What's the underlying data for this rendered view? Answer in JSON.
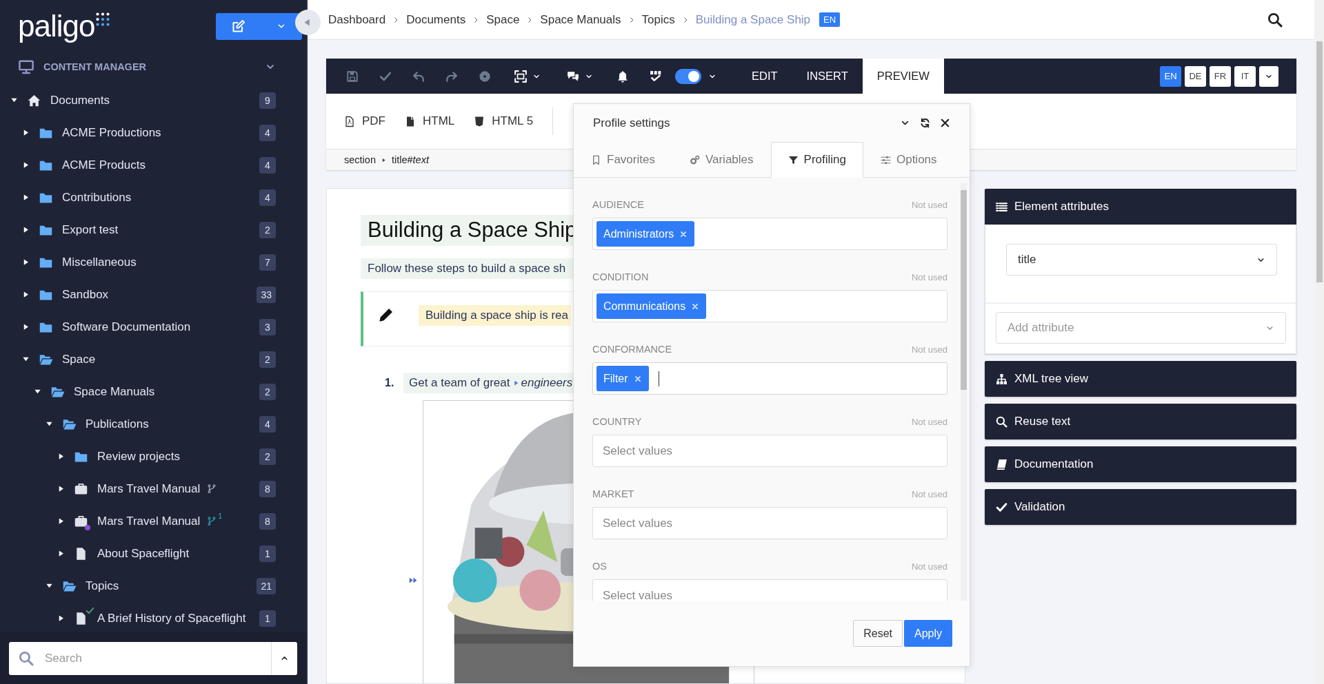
{
  "sidebar": {
    "logo": "paligo",
    "section": "CONTENT MANAGER",
    "tree": [
      {
        "kind": "home",
        "label": "Documents",
        "count": "9",
        "expanded": true,
        "children": [
          {
            "kind": "folder",
            "label": "ACME Productions",
            "count": "4",
            "expanded": false
          },
          {
            "kind": "folder",
            "label": "ACME Products",
            "count": "4",
            "expanded": false
          },
          {
            "kind": "folder",
            "label": "Contributions",
            "count": "4",
            "expanded": false
          },
          {
            "kind": "folder",
            "label": "Export test",
            "count": "2",
            "expanded": false
          },
          {
            "kind": "folder",
            "label": "Miscellaneous",
            "count": "7",
            "expanded": false
          },
          {
            "kind": "folder",
            "label": "Sandbox",
            "count": "33",
            "expanded": false
          },
          {
            "kind": "folder",
            "label": "Software Documentation",
            "count": "3",
            "expanded": false
          },
          {
            "kind": "folder",
            "label": "Space",
            "count": "2",
            "expanded": true,
            "children": [
              {
                "kind": "folder",
                "label": "Space Manuals",
                "count": "2",
                "expanded": true,
                "children": [
                  {
                    "kind": "folder",
                    "label": "Publications",
                    "count": "4",
                    "expanded": true,
                    "children": [
                      {
                        "kind": "folder",
                        "label": "Review projects",
                        "count": "2",
                        "expanded": false
                      },
                      {
                        "kind": "publication",
                        "label": "Mars Travel Manual",
                        "count": "8",
                        "expanded": false,
                        "branch": true
                      },
                      {
                        "kind": "publication",
                        "label": "Mars Travel Manual",
                        "count": "8",
                        "expanded": false,
                        "branch": true,
                        "branch_count": "1",
                        "color": "#8a4fd8"
                      },
                      {
                        "kind": "topic",
                        "label": "About Spaceflight",
                        "count": "1",
                        "expanded": false
                      }
                    ]
                  },
                  {
                    "kind": "folder",
                    "label": "Topics",
                    "count": "21",
                    "expanded": true,
                    "children": [
                      {
                        "kind": "topic",
                        "label": "A Brief History of Spaceflight",
                        "count": "1",
                        "expanded": false,
                        "approved": true
                      }
                    ]
                  }
                ]
              }
            ]
          }
        ]
      }
    ],
    "search": {
      "placeholder": "Search"
    }
  },
  "breadcrumb": {
    "items": [
      "Dashboard",
      "Documents",
      "Space",
      "Space Manuals",
      "Topics"
    ],
    "current": "Building a Space Ship",
    "language": "EN"
  },
  "editor": {
    "toolbar": [
      {
        "kind": "save",
        "disabled": true
      },
      {
        "kind": "check",
        "disabled": true
      },
      {
        "kind": "undo",
        "disabled": true
      },
      {
        "kind": "redo",
        "disabled": true
      },
      {
        "kind": "settings",
        "disabled": true
      },
      {
        "kind": "frame",
        "disabled": false,
        "menu": true
      },
      {
        "kind": "comments",
        "disabled": false,
        "menu": true
      },
      {
        "kind": "notifications",
        "disabled": false
      },
      {
        "kind": "spellcheck",
        "disabled": false
      }
    ],
    "spellcheck_toggle": {
      "on": true
    },
    "tabs": [
      {
        "label": "EDIT",
        "selected": false
      },
      {
        "label": "INSERT",
        "selected": false
      },
      {
        "label": "PREVIEW",
        "selected": true
      }
    ],
    "languages": [
      {
        "label": "EN",
        "selected": true
      },
      {
        "label": "DE",
        "selected": false
      },
      {
        "label": "FR",
        "selected": false
      },
      {
        "label": "IT",
        "selected": false
      }
    ],
    "outputs": [
      {
        "kind": "pdf",
        "label": "PDF"
      },
      {
        "kind": "html",
        "label": "HTML"
      },
      {
        "kind": "html5",
        "label": "HTML 5"
      }
    ],
    "element_path": [
      "section",
      "title#*text*"
    ]
  },
  "document": {
    "title": "Building a Space Ship",
    "intro": "Follow these steps to build a space sh",
    "note": "Building a space ship is rea",
    "steps": [
      {
        "number": "1.",
        "text": "Get a team of great",
        "term": "engineers"
      }
    ]
  },
  "profile_settings": {
    "title": "Profile settings",
    "tabs": [
      {
        "kind": "favorites",
        "label": "Favorites",
        "selected": false
      },
      {
        "kind": "variables",
        "label": "Variables",
        "selected": false
      },
      {
        "kind": "profiling",
        "label": "Profiling",
        "selected": true
      },
      {
        "kind": "options",
        "label": "Options",
        "selected": false
      }
    ],
    "fields": [
      {
        "label": "AUDIENCE",
        "status": "Not used",
        "values": [
          "Administrators"
        ],
        "focused": false
      },
      {
        "label": "CONDITION",
        "status": "Not used",
        "values": [
          "Communications"
        ],
        "focused": false
      },
      {
        "label": "CONFORMANCE",
        "status": "Not used",
        "values": [
          "Filter"
        ],
        "focused": true
      },
      {
        "label": "COUNTRY",
        "status": "Not used",
        "placeholder": "Select values",
        "focused": false
      },
      {
        "label": "MARKET",
        "status": "Not used",
        "placeholder": "Select values",
        "focused": false
      },
      {
        "label": "OS",
        "status": "Not used",
        "placeholder": "Select values",
        "focused": false
      }
    ],
    "buttons": [
      {
        "kind": "secondary",
        "label": "Reset"
      },
      {
        "kind": "primary",
        "label": "Apply"
      }
    ]
  },
  "panels": [
    {
      "kind": "attributes",
      "title": "Element attributes",
      "expanded": true,
      "element": "title",
      "add_placeholder": "Add attribute"
    },
    {
      "kind": "tree",
      "title": "XML tree view",
      "expanded": false
    },
    {
      "kind": "search",
      "title": "Reuse text",
      "expanded": false
    },
    {
      "kind": "docs",
      "title": "Documentation",
      "expanded": false
    },
    {
      "kind": "validation",
      "title": "Validation",
      "expanded": false
    }
  ]
}
